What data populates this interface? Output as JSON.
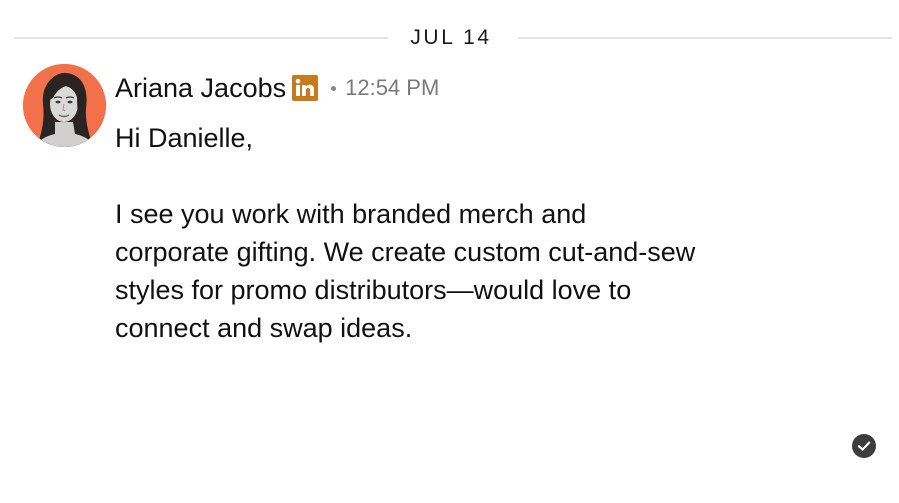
{
  "conversation": {
    "date_divider": "JUL 14"
  },
  "message": {
    "sender_name": "Ariana Jacobs",
    "sender_icon": "linkedin-icon",
    "timestamp": "12:54 PM",
    "greeting": "Hi Danielle,",
    "body_lines": [
      "I see you work with branded merch and",
      "corporate gifting. We create custom cut-and-sew",
      "styles for promo distributors—would love to",
      "connect and swap ideas."
    ],
    "status_icon": "read-check-icon"
  },
  "colors": {
    "avatar_background": "#f2704a",
    "linkedin_badge": "#c97a1a",
    "timestamp": "#7a7a7a",
    "divider": "#e4e4e4"
  }
}
